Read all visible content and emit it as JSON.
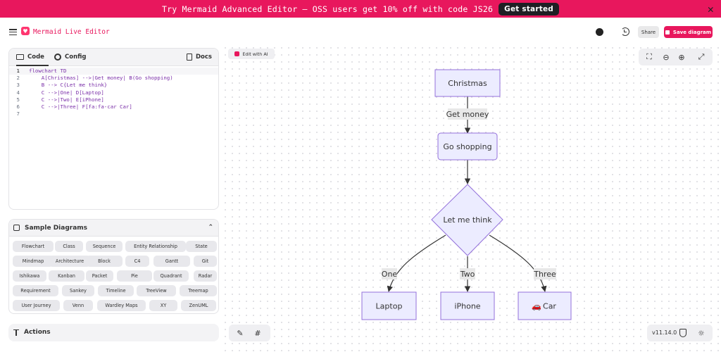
{
  "banner": {
    "text": "Try Mermaid Advanced Editor — OSS users get 10% off with code JS26",
    "cta": "Get started",
    "close": "✕"
  },
  "header": {
    "title": "Mermaid Live Editor",
    "share": "Share",
    "save": "Save diagram"
  },
  "editor": {
    "tabs": {
      "code": "Code",
      "config": "Config",
      "docs": "Docs"
    },
    "line_numbers": [
      "1",
      "2",
      "3",
      "4",
      "5",
      "6",
      "7"
    ],
    "lines": [
      "flowchart TD",
      "    A[Christmas] -->|Get money| B(Go shopping)",
      "    B --> C{Let me think}",
      "    C -->|One| D[Laptop]",
      "    C -->|Two| E[iPhone]",
      "    C -->|Three| F[fa:fa-car Car]",
      ""
    ]
  },
  "samples": {
    "title": "Sample Diagrams",
    "rows": [
      [
        "Flowchart",
        "Class",
        "Sequence",
        "Entity Relationship",
        "State"
      ],
      [
        "Mindmap",
        "Architecture",
        "Block",
        "C4",
        "Gantt",
        "Git"
      ],
      [
        "Ishikawa",
        "Kanban",
        "Packet",
        "Pie",
        "Quadrant",
        "Radar"
      ],
      [
        "Requirement",
        "Sankey",
        "Timeline",
        "TreeView",
        "Treemap"
      ],
      [
        "User Journey",
        "Venn",
        "Wardley Maps",
        "XY",
        "ZenUML"
      ]
    ]
  },
  "actions": {
    "title": "Actions"
  },
  "canvas": {
    "edit_ai": "Edit with AI",
    "version": "v11.14.0"
  },
  "diagram": {
    "nodes": {
      "christmas": "Christmas",
      "shopping": "Go shopping",
      "think": "Let me think",
      "laptop": "Laptop",
      "iphone": "iPhone",
      "car": "Car"
    },
    "edges": {
      "money": "Get money",
      "one": "One",
      "two": "Two",
      "three": "Three"
    },
    "colors": {
      "fill": "#ECECFF",
      "stroke": "#9370DB",
      "line": "#333333",
      "label_bg": "#e8e8e8"
    },
    "icons": {
      "car": "fa-car"
    }
  }
}
